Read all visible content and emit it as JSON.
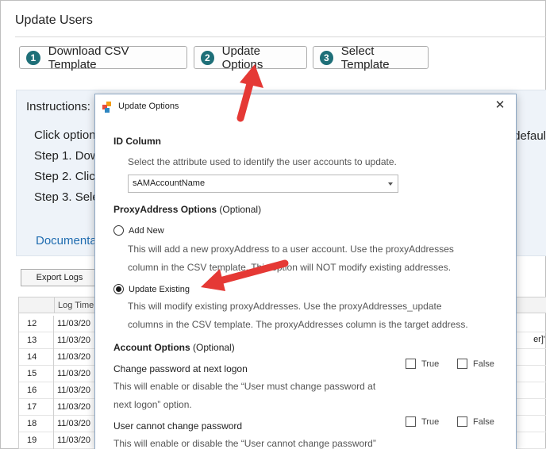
{
  "app": {
    "title": "Update Users"
  },
  "steps": [
    {
      "num": "1",
      "label": "Download CSV Template"
    },
    {
      "num": "2",
      "label": "Update Options"
    },
    {
      "num": "3",
      "label": "Select Template"
    }
  ],
  "instructions": {
    "label": "Instructions:",
    "lines": [
      "Click option",
      "Step 1. Dow",
      "Step 2. Click",
      "Step 3. Sele"
    ],
    "right_text": "defaul",
    "link": "Documenta"
  },
  "log": {
    "export_label": "Export Logs",
    "column_header": "Log Time",
    "rows": [
      {
        "n": "12",
        "time": "11/03/20"
      },
      {
        "n": "13",
        "time": "11/03/20"
      },
      {
        "n": "14",
        "time": "11/03/20"
      },
      {
        "n": "15",
        "time": "11/03/20"
      },
      {
        "n": "16",
        "time": "11/03/20"
      },
      {
        "n": "17",
        "time": "11/03/20"
      },
      {
        "n": "18",
        "time": "11/03/20"
      },
      {
        "n": "19",
        "time": "11/03/20"
      }
    ],
    "tail_text": "er]'"
  },
  "dialog": {
    "title": "Update Options",
    "close_icon": "close-icon",
    "id_column": {
      "heading": "ID Column",
      "description": "Select the attribute used to identify the user accounts to update.",
      "selected": "sAMAccountName"
    },
    "proxy": {
      "heading": "ProxyAddress Options",
      "optional": "(Optional)",
      "add_new": {
        "label": "Add New",
        "desc1": "This will add a new proxyAddress to a user account. Use the proxyAddresses",
        "desc2": "column in the CSV template. This option will NOT modify existing addresses.",
        "selected": false
      },
      "update_existing": {
        "label": "Update Existing",
        "desc1": "This will modify existing proxyAddresses. Use the proxyAddresses_update",
        "desc2": "columns in the CSV template. The proxyAddresses column is the target address.",
        "selected": true
      }
    },
    "account": {
      "heading": "Account Options",
      "optional": "(Optional)",
      "true_label": "True",
      "false_label": "False",
      "options": [
        {
          "label": "Change password at next logon",
          "desc1": "This will enable or disable the “User must change password at",
          "desc2": "next logon” option."
        },
        {
          "label": "User cannot change password",
          "desc1": "This will enable or disable the “User cannot change password”",
          "desc2": ""
        }
      ]
    }
  },
  "colors": {
    "step_badge": "#1e6f78",
    "arrow": "#e53935",
    "link": "#1f6cb0"
  }
}
